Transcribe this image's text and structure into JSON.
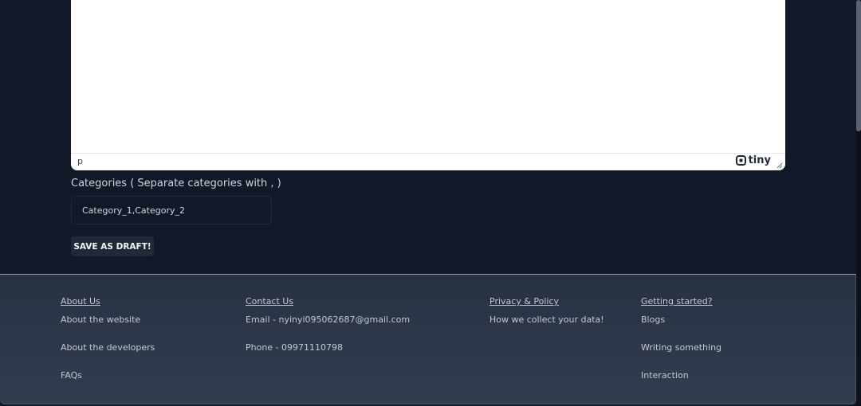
{
  "editor": {
    "status_path": "p",
    "brand": "tiny"
  },
  "categories": {
    "label": "Categories ( Separate categories with , )",
    "value": "Category_1,Category_2"
  },
  "actions": {
    "save_draft_label": "SAVE AS DRAFT!"
  },
  "footer": {
    "about": {
      "heading": "About Us",
      "items": [
        "About the website",
        "About the developers",
        "FAQs"
      ]
    },
    "contact": {
      "heading": "Contact Us",
      "items": [
        "Email - nyinyi095062687@gmail.com",
        "Phone - 09971110798"
      ]
    },
    "privacy": {
      "heading": "Privacy & Policy",
      "items": [
        "How we collect your data!"
      ]
    },
    "started": {
      "heading": "Getting started?",
      "items": [
        "Blogs",
        "Writing something",
        "Interaction"
      ]
    }
  },
  "colors": {
    "page_background": "#111827",
    "footer_background": "#2d3748",
    "button_background": "#1f2937"
  }
}
